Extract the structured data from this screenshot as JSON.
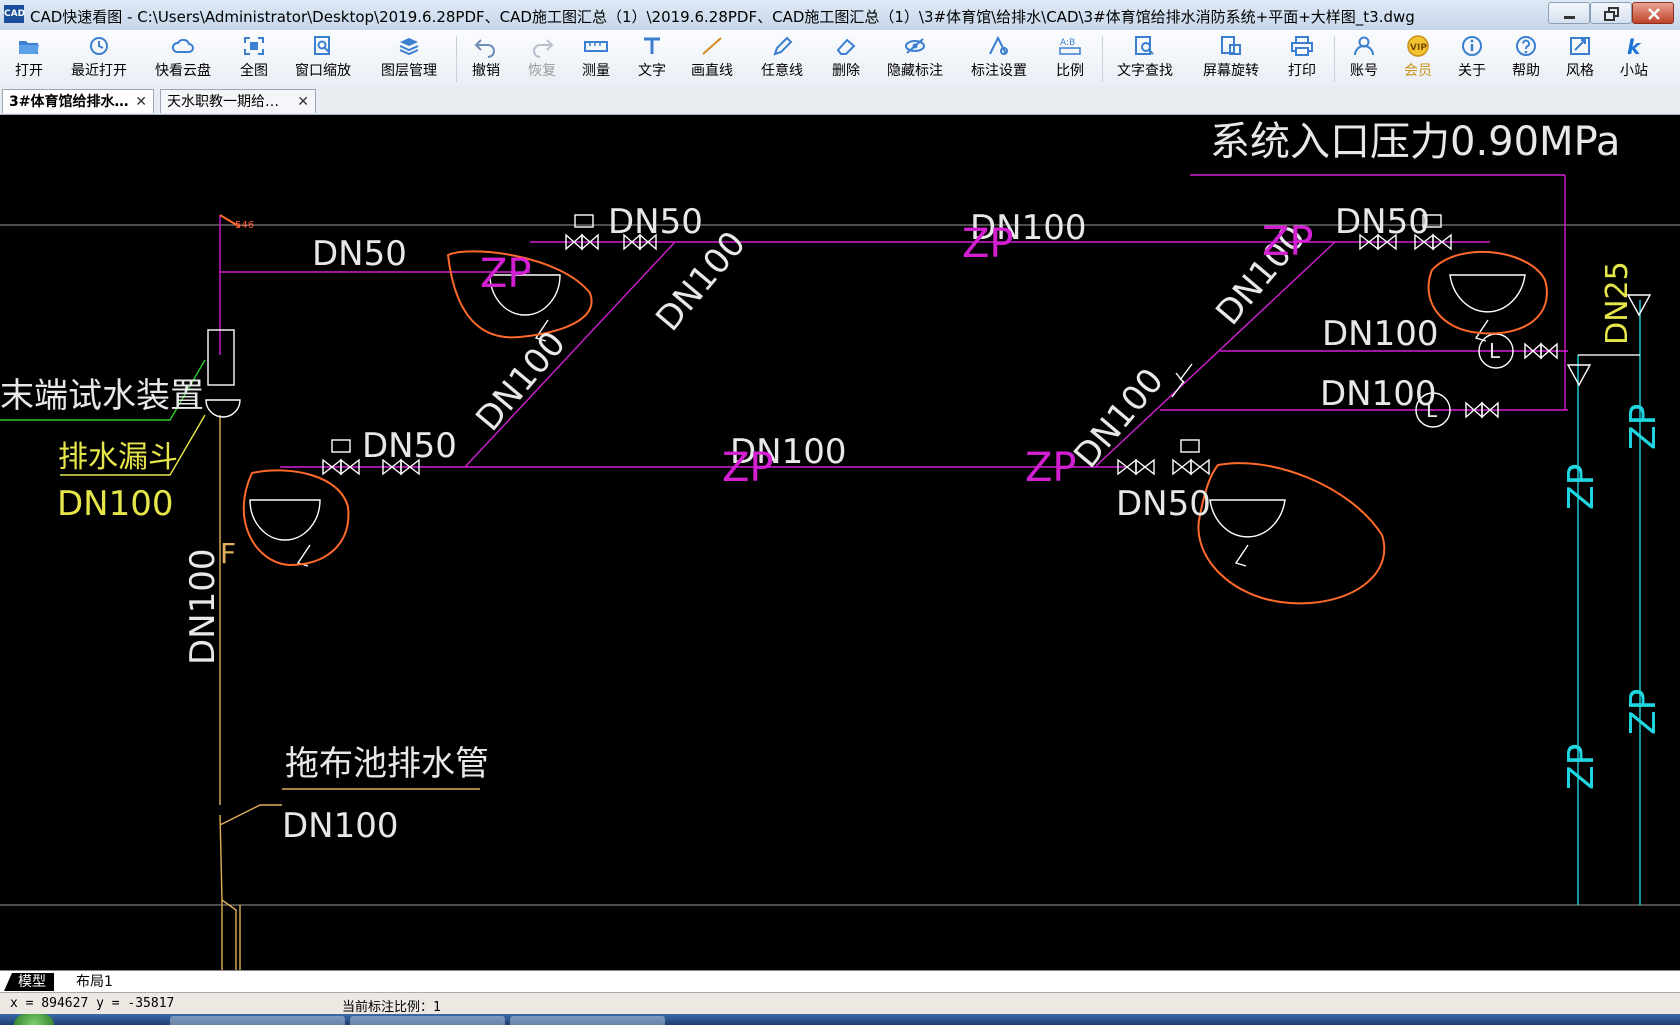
{
  "window": {
    "app_icon": "CAD",
    "title": "CAD快速看图 - C:\\Users\\Administrator\\Desktop\\2019.6.28PDF、CAD施工图汇总（1）\\2019.6.28PDF、CAD施工图汇总（1）\\3#体育馆\\给排水\\CAD\\3#体育馆给排水消防系统+平面+大样图_t3.dwg"
  },
  "toolbar": {
    "items": [
      {
        "label": "打开",
        "icon": "folder-open-icon"
      },
      {
        "label": "最近打开",
        "icon": "clock-icon"
      },
      {
        "label": "快看云盘",
        "icon": "cloud-icon"
      },
      {
        "label": "全图",
        "icon": "fullview-icon"
      },
      {
        "label": "窗口缩放",
        "icon": "zoom-window-icon"
      },
      {
        "label": "图层管理",
        "icon": "layers-icon"
      },
      {
        "label": "撤销",
        "icon": "undo-icon"
      },
      {
        "label": "恢复",
        "icon": "redo-icon"
      },
      {
        "label": "测量",
        "icon": "ruler-icon"
      },
      {
        "label": "文字",
        "icon": "text-icon"
      },
      {
        "label": "画直线",
        "icon": "line-icon"
      },
      {
        "label": "任意线",
        "icon": "pen-icon"
      },
      {
        "label": "删除",
        "icon": "eraser-icon"
      },
      {
        "label": "隐藏标注",
        "icon": "eye-hide-icon"
      },
      {
        "label": "标注设置",
        "icon": "annotation-settings-icon"
      },
      {
        "label": "比例",
        "icon": "scale-icon"
      },
      {
        "label": "文字查找",
        "icon": "text-search-icon"
      },
      {
        "label": "屏幕旋转",
        "icon": "rotate-screen-icon"
      },
      {
        "label": "打印",
        "icon": "printer-icon"
      },
      {
        "label": "账号",
        "icon": "user-icon"
      },
      {
        "label": "会员",
        "icon": "vip-icon"
      },
      {
        "label": "关于",
        "icon": "info-icon"
      },
      {
        "label": "帮助",
        "icon": "help-icon"
      },
      {
        "label": "风格",
        "icon": "style-icon"
      },
      {
        "label": "小站",
        "icon": "k-icon"
      }
    ]
  },
  "tabs": [
    {
      "label": "3#体育馆给排水…",
      "active": true
    },
    {
      "label": "天水职教一期给…",
      "active": false
    }
  ],
  "drawing": {
    "labels": {
      "system_pressure": "系统入口压力0.90MPa",
      "dn50_a": "DN50",
      "dn50_b": "DN50",
      "dn50_c": "DN50",
      "dn50_d": "DN50",
      "dn50_e": "DN50",
      "dn100_top": "DN100",
      "dn100_mid": "DN100",
      "dn100_diag1": "DN100",
      "dn100_diag2": "DN100",
      "dn100_diag3": "DN100",
      "dn100_diag4": "DN100",
      "dn100_r1": "DN100",
      "dn100_r2": "DN100",
      "dn100_vert": "DN100",
      "dn100_yellow": "DN100",
      "dn100_bottom": "DN100",
      "dn25": "DN25",
      "zp_1": "ZP",
      "zp_2": "ZP",
      "zp_3": "ZP",
      "zp_4": "ZP",
      "zp_5": "ZP",
      "zp_cyan_1": "ZP",
      "zp_cyan_2": "ZP",
      "zp_cyan_3": "ZP",
      "zp_cyan_4": "ZP",
      "end_test_device": "末端试水装置",
      "drain_funnel": "排水漏斗",
      "mop_pool_drain": "拖布池排水管",
      "f_mark": "F",
      "small_red": "546",
      "meter_1": "L",
      "meter_2": "L"
    }
  },
  "layout_tabs": [
    {
      "label": "模型",
      "active": true
    },
    {
      "label": "布局1",
      "active": false
    }
  ],
  "status": {
    "coords": "x = 894627  y = -35817",
    "scale": "当前标注比例：1"
  }
}
